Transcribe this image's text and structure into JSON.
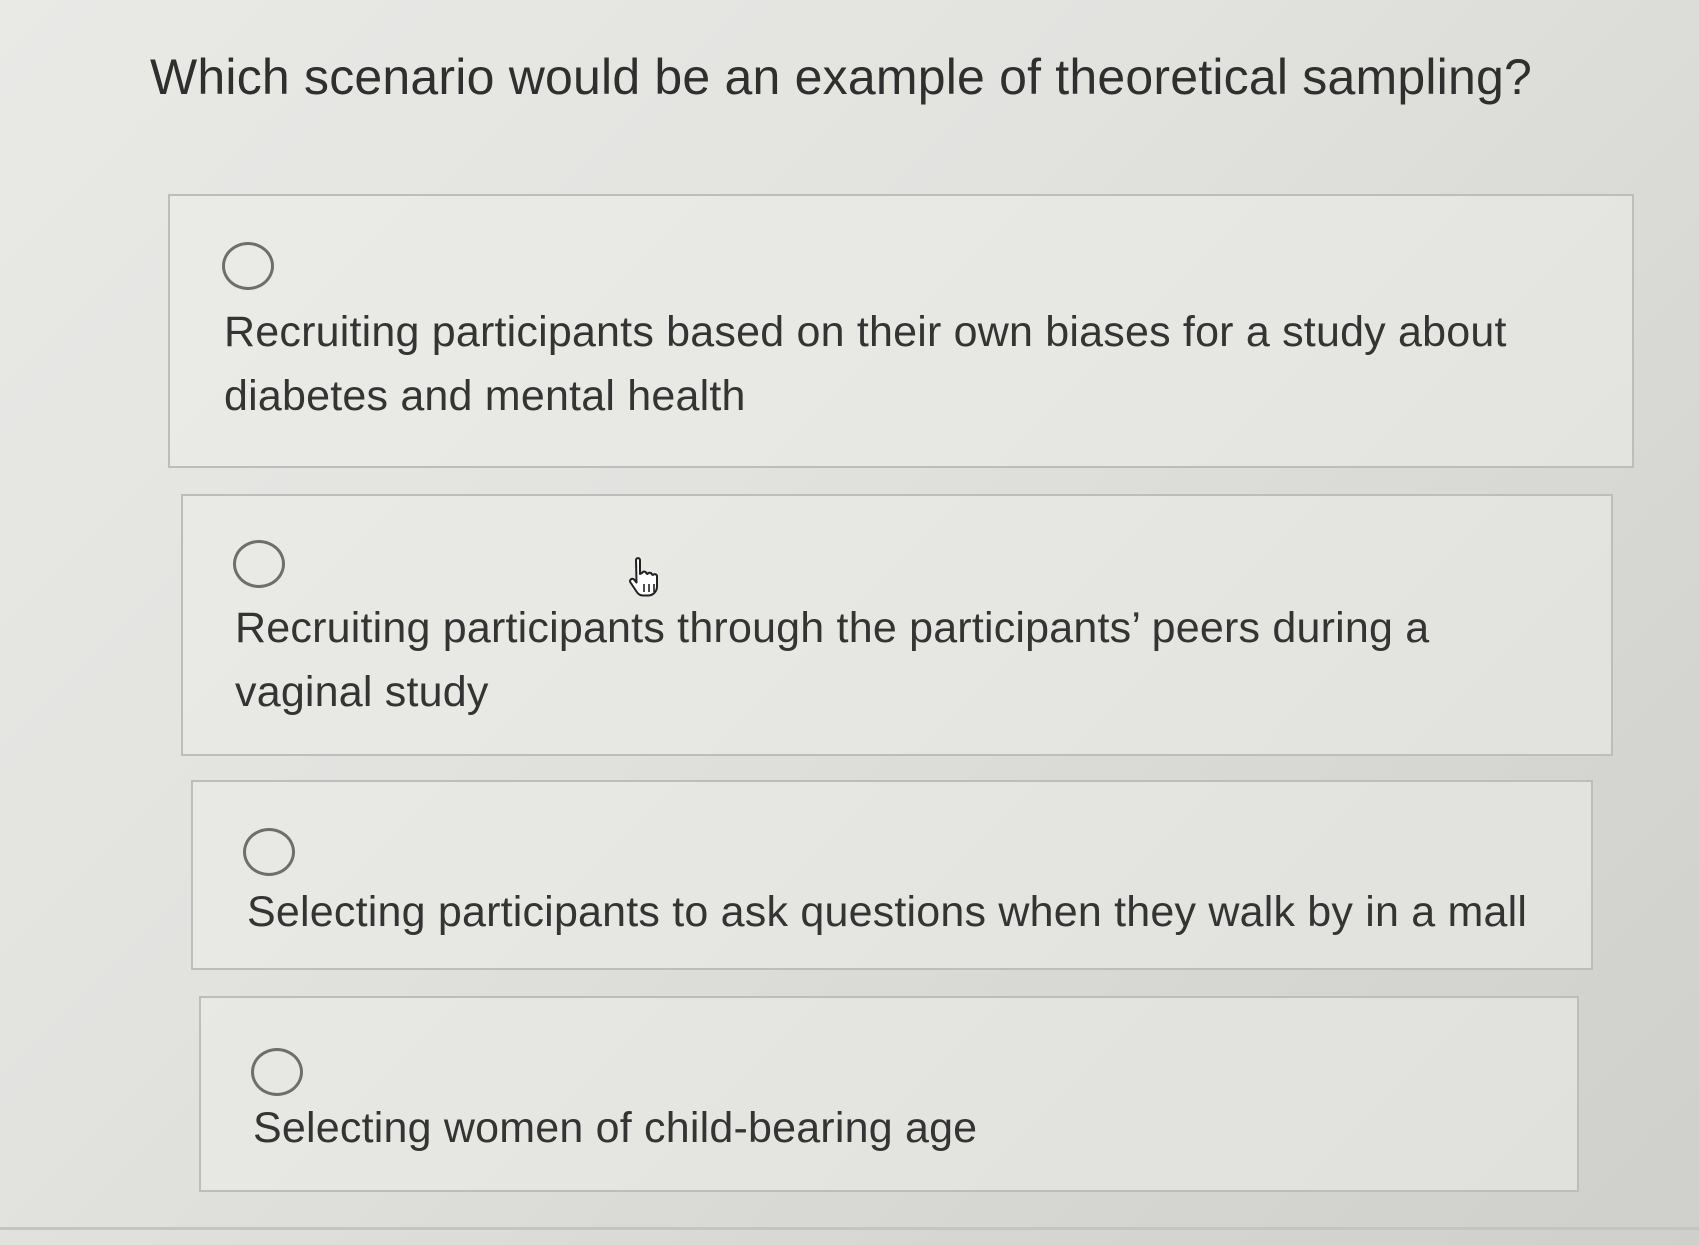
{
  "question": {
    "text": "Which scenario would be an example of theoretical sampling?"
  },
  "options": [
    {
      "label": "Recruiting participants based on their own biases for a study about diabetes and mental health",
      "selected": false,
      "icon": "radio-unselected-icon"
    },
    {
      "label": "Recruiting participants through the participants’ peers during a vaginal study",
      "selected": false,
      "icon": "radio-unselected-icon"
    },
    {
      "label": "Selecting participants to ask questions when they walk by in a mall",
      "selected": false,
      "icon": "radio-unselected-icon"
    },
    {
      "label": "Selecting women of child-bearing age",
      "selected": false,
      "icon": "radio-unselected-icon"
    }
  ],
  "cursor": {
    "icon": "hand-pointer-cursor-icon"
  },
  "colors": {
    "background": "#e2e2df",
    "border": "#bdbdba",
    "text": "#333333"
  }
}
